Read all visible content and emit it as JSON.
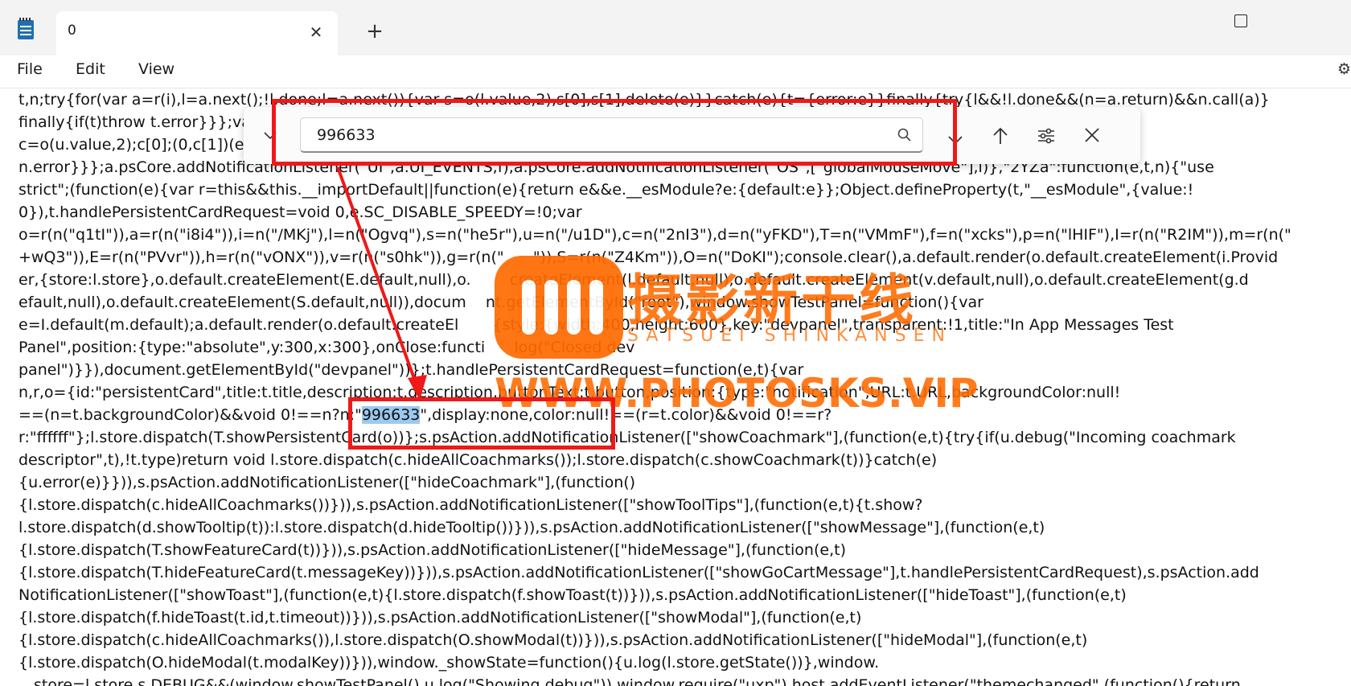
{
  "tab": {
    "title": "0"
  },
  "menu": {
    "file": "File",
    "edit": "Edit",
    "view": "View"
  },
  "find": {
    "query": "996633"
  },
  "code_lines": [
    "t,n;try{for(var a=r(i),l=a.next();!l.done;l=a.next()){var s=o(l.value,2),s[0],s[1],delete(e)}}catch(e){t={error:e}}finally{try{l&&!l.done&&(n=a.return)&&n.call(a)}",
    "finally{if(t)throw t.error}}};var                                                                                                                         s.next()){var",
    "c=o(u.value,2);c[0];(0,c[1])(e",
    "n.error}}};a.psCore.addNotificationListener(\"UI\",a.UI_EVENTS,f),a.psCore.addNotificationListener(\"OS\",[\"globalMouseMove\"],l)},\"2YZa\":function(e,t,n){\"use",
    "strict\";(function(e){var r=this&&this.__importDefault||function(e){return e&&e.__esModule?e:{default:e}};Object.defineProperty(t,\"__esModule\",{value:!",
    "0}),t.handlePersistentCardRequest=void 0,e.SC_DISABLE_SPEEDY=!0;var",
    "o=r(n(\"q1tI\")),a=r(n(\"i8i4\")),i=n(\"/MKj\"),l=n(\"Ogvq\"),s=n(\"he5r\"),u=n(\"/u1D\"),c=n(\"2nI3\"),d=n(\"yFKD\"),T=n(\"VMmF\"),f=n(\"xcks\"),p=n(\"lHIF\"),I=r(n(\"R2IM\")),m=r(n(\"",
    "+wQ3\")),E=r(n(\"PVvr\")),h=r(n(\"vONX\")),v=r(n(\"s0hk\")),g=r(n(\"      \")),S=r(n(\"Z4Km\")),O=n(\"DoKI\");console.clear(),a.default.render(o.default.createElement(i.Provid",
    "er,{store:l.store},o.default.createElement(E.default,null),o.        createElement(l.default,null),o.default.createElement(v.default,null),o.default.createElement(g.d",
    "efault,null),o.default.createElement(S.default,null)),docum    nt.getElementById(\"root\"),window.showTestPanel=function(){var",
    "e=I.default(m.default);a.default.render(o.default.createEl       {style:{width:400,height:600},key:\"devpanel\",transparent:!1,title:\"In App Messages Test",
    "Panel\",position:{type:\"absolute\",y:300,x:300},onClose:functi      log(\"Closed dev",
    "panel\")}}),document.getElementById(\"devpanel\"))};t.handlePersistentCardRequest=function(e,t){var",
    "n,r,o={id:\"persistentCard\",title:t.title,description:t.description,buttonText:t.button,position:{type:\"notification\",URL:t.URL,backgroundColor:null!",
    "==(n=t.backgroundColor)&&void 0!==n?n:\"",
    "r:\"ffffff\"};l.store.dispatch(T.showPersistentCard(o))};s.psAction.addNotificationListener([\"showCoachmark\"],(function(e,t){try{if(u.debug(\"Incoming coachmark",
    "descriptor\",t),!t.type)return void l.store.dispatch(c.hideAllCoachmarks());l.store.dispatch(c.showCoachmark(t))}catch(e)",
    "{u.error(e)}})),s.psAction.addNotificationListener([\"hideCoachmark\"],(function()",
    "{l.store.dispatch(c.hideAllCoachmarks())})),s.psAction.addNotificationListener([\"showToolTips\"],(function(e,t){t.show?",
    "l.store.dispatch(d.showTooltip(t)):l.store.dispatch(d.hideTooltip())})),s.psAction.addNotificationListener([\"showMessage\"],(function(e,t)",
    "{l.store.dispatch(T.showFeatureCard(t))})),s.psAction.addNotificationListener([\"hideMessage\"],(function(e,t)",
    "{l.store.dispatch(T.hideFeatureCard(t.messageKey))})),s.psAction.addNotificationListener([\"showGoCartMessage\"],t.handlePersistentCardRequest),s.psAction.add",
    "NotificationListener([\"showToast\"],(function(e,t){l.store.dispatch(f.showToast(t))})),s.psAction.addNotificationListener([\"hideToast\"],(function(e,t)",
    "{l.store.dispatch(f.hideToast(t.id,t.timeout))})),s.psAction.addNotificationListener([\"showModal\"],(function(e,t)",
    "{l.store.dispatch(c.hideAllCoachmarks()),l.store.dispatch(O.showModal(t))})),s.psAction.addNotificationListener([\"hideModal\"],(function(e,t)",
    "{l.store.dispatch(O.hideModal(t.modalKey))})),window._showState=function(){u.log(l.store.getState())},window.",
    "__store=l.store,s.DEBUG&&(window.showTestPanel(),u.log(\"Showing debug\")),window.require(\"uxp\").host.addEventListener(\"themechanged\",(function(){return"
  ],
  "highlight_line": {
    "before": "==(n=t.backgroundColor)&&void 0!==n?n:\"",
    "match": "996633",
    "after": "\",display:none,color:null!==(r=t.color)&&void 0!==r?"
  },
  "watermark": {
    "cn": "摄影新干线",
    "en": "SATSUEI SHINKANSEN",
    "url": "WWW.PHOTOSKS.VIP"
  }
}
